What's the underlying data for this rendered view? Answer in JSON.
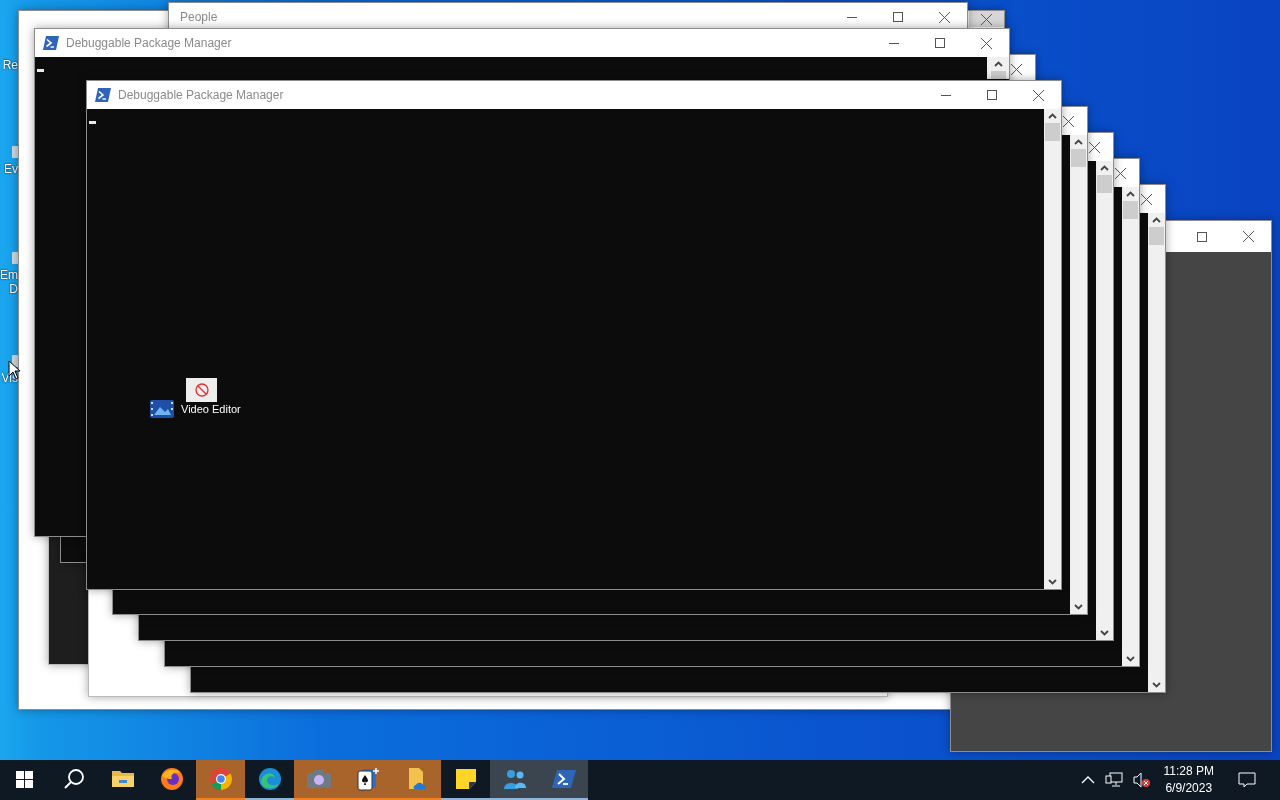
{
  "desktop_icons": [
    {
      "label": "Re",
      "icon": false
    },
    {
      "label": "Ev",
      "icon": true
    },
    {
      "label": "Em",
      "label_2": "D",
      "icon": true
    },
    {
      "label": "Vis",
      "icon": true
    }
  ],
  "windows": [
    {
      "kind": "blank"
    },
    {
      "kind": "titled",
      "title": "People"
    },
    {
      "kind": "dark"
    },
    {
      "kind": "plain"
    },
    {
      "kind": "grey"
    },
    {
      "kind": "stack"
    },
    {
      "kind": "stack"
    },
    {
      "kind": "stack"
    },
    {
      "kind": "stack"
    },
    {
      "kind": "behind"
    },
    {
      "kind": "console_back",
      "title": "Debuggable Package Manager"
    },
    {
      "kind": "console",
      "title": "Debuggable Package Manager"
    }
  ],
  "drag": {
    "label": "Video Editor",
    "allowed": false
  },
  "taskbar": {
    "items": [
      {
        "kind": "start",
        "flashing": false,
        "running": false,
        "active": false
      },
      {
        "kind": "search",
        "flashing": false,
        "running": false,
        "active": false
      },
      {
        "kind": "explorer",
        "flashing": false,
        "running": false,
        "active": false
      },
      {
        "kind": "firefox",
        "flashing": false,
        "running": false,
        "active": false
      },
      {
        "kind": "chrome",
        "flashing": true,
        "running": true,
        "active": false
      },
      {
        "kind": "edge",
        "flashing": false,
        "running": true,
        "active": false
      },
      {
        "kind": "camera",
        "flashing": true,
        "running": true,
        "active": false
      },
      {
        "kind": "solitaire",
        "flashing": true,
        "running": true,
        "active": false
      },
      {
        "kind": "files",
        "flashing": true,
        "running": true,
        "active": false
      },
      {
        "kind": "sticky",
        "flashing": false,
        "running": true,
        "active": false
      },
      {
        "kind": "people",
        "flashing": false,
        "running": true,
        "active": true
      },
      {
        "kind": "powershell",
        "flashing": false,
        "running": true,
        "active": true
      }
    ],
    "volume_muted": true,
    "time": "11:28 PM",
    "date": "6/9/2023"
  }
}
